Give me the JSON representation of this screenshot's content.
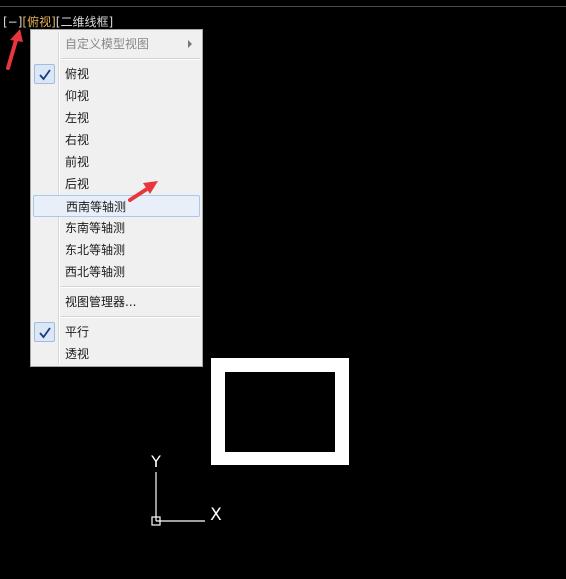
{
  "viewport_controls": {
    "minimize": "[−]",
    "view": "[俯视]",
    "visual_style": "[二维线框]"
  },
  "menu": {
    "custom_views": "自定义模型视图",
    "views": [
      "俯视",
      "仰视",
      "左视",
      "右视",
      "前视",
      "后视",
      "西南等轴测",
      "东南等轴测",
      "东北等轴测",
      "西北等轴测"
    ],
    "checked_view": "俯视",
    "highlighted_view": "西南等轴测",
    "view_manager": "视图管理器...",
    "projections": [
      "平行",
      "透视"
    ],
    "checked_projection": "平行"
  },
  "ucs": {
    "x_label": "X",
    "y_label": "Y"
  },
  "colors": {
    "background": "#000000",
    "active_view_label": "#e7b15a",
    "annotation_arrow": "#e8363d",
    "menu_background": "#f0f0f0",
    "check_mark": "#1a3a8a"
  },
  "icons": [
    "check-icon",
    "submenu-arrow-icon",
    "annotation-arrow-icon"
  ]
}
